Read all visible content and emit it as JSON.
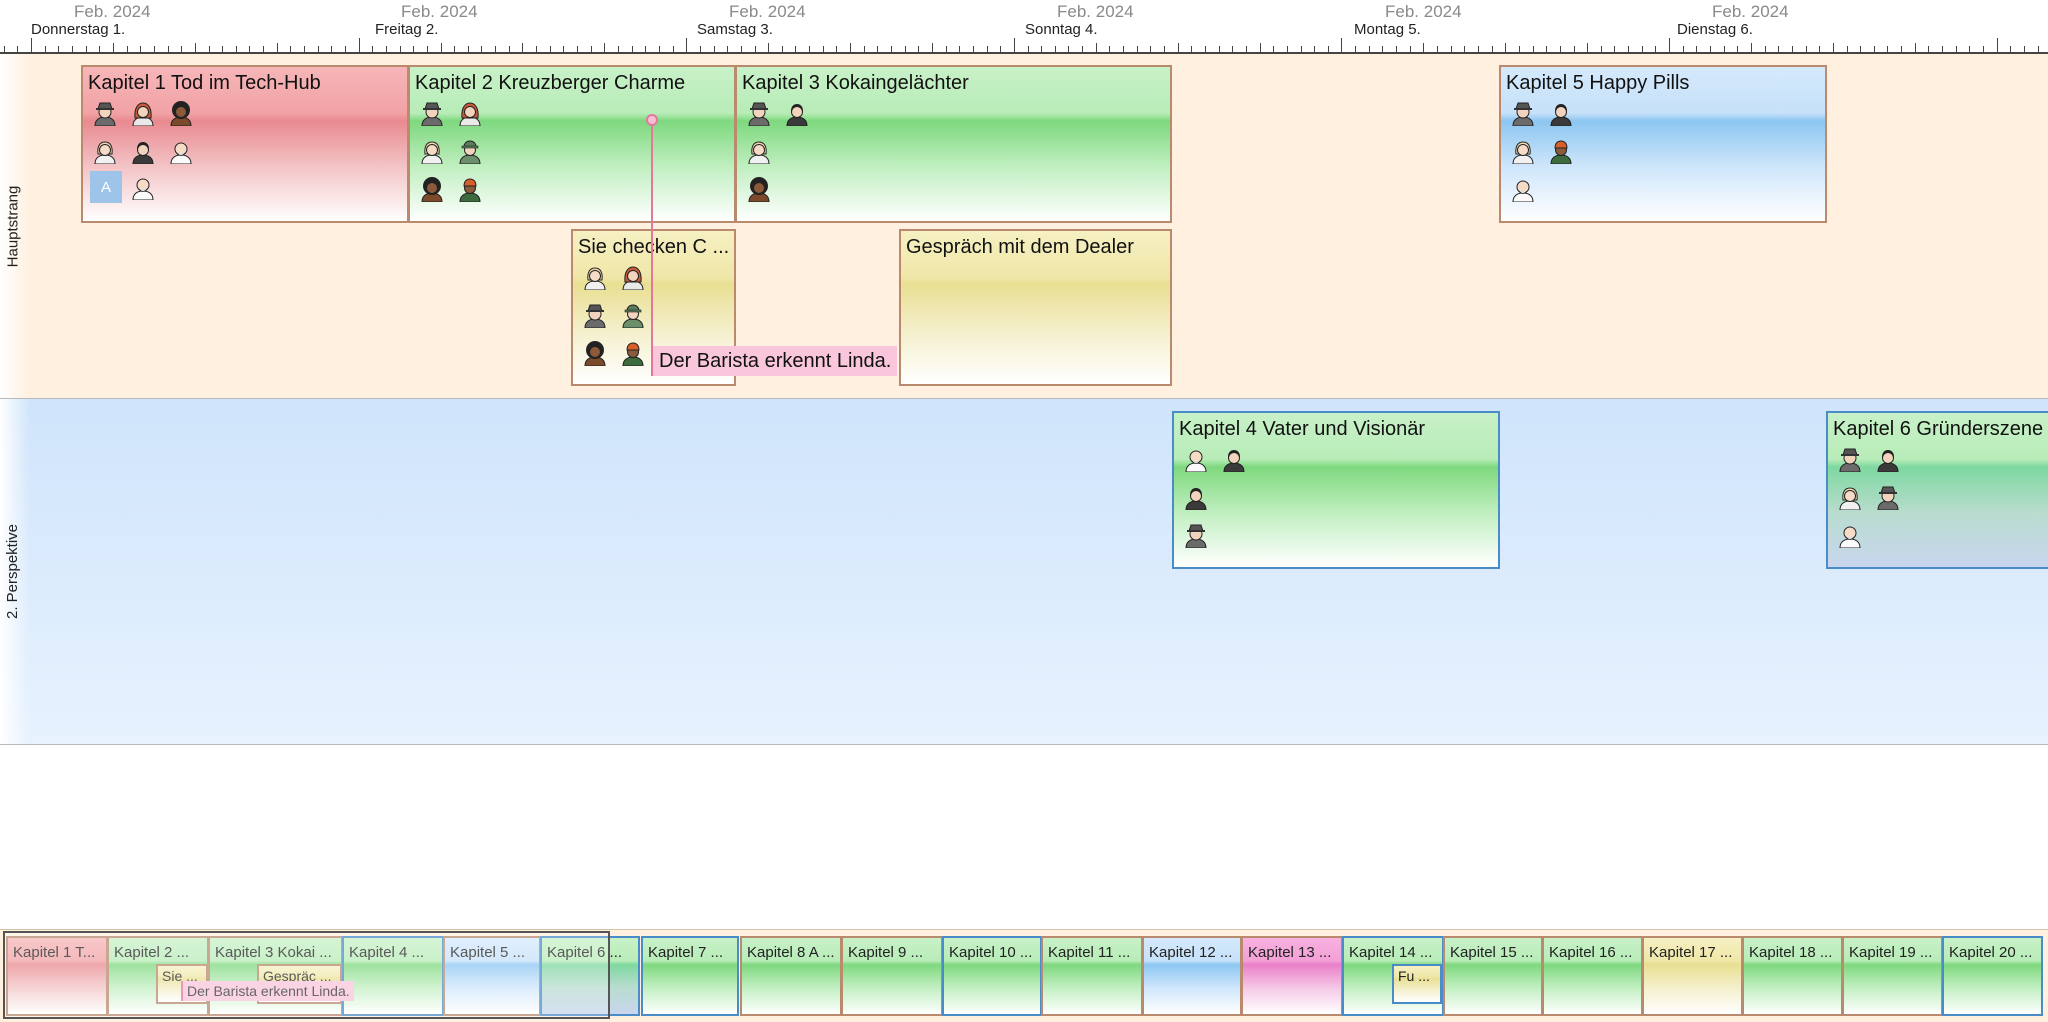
{
  "timeline": {
    "month_label": "Feb. 2024",
    "days": [
      "Donnerstag 1.",
      "Freitag 2.",
      "Samstag 3.",
      "Sonntag 4.",
      "Montag 5.",
      "Dienstag 6."
    ]
  },
  "lanes": {
    "main": "Hauptstrang",
    "perspective": "2. Perspektive"
  },
  "events": {
    "k1": "Kapitel 1 Tod im Tech-Hub",
    "k1_box": "A",
    "k2": "Kapitel 2 Kreuzberger Charme",
    "k3": "Kapitel 3 Kokaingelächter",
    "k5": "Kapitel 5 Happy Pills",
    "sie": "Sie checken C ...",
    "dealer": "Gespräch mit dem Dealer",
    "k4": "Kapitel 4 Vater und Visionär",
    "k6": "Kapitel 6 Gründerszene"
  },
  "note": "Der Barista erkennt Linda.",
  "overview": {
    "items": [
      "Kapitel 1 T...",
      "Kapitel 2 ...",
      "Kapitel 3 Kokai ...",
      "Kapitel 4 ...",
      "Kapitel 5 ...",
      "Kapitel 6 ...",
      "Kapitel 7 ...",
      "Kapitel 8 A ...",
      "Kapitel 9 ...",
      "Kapitel 10 ...",
      "Kapitel 11 ...",
      "Kapitel 12 ...",
      "Kapitel 13 ...",
      "Kapitel 14 ...",
      "Kapitel 15 ...",
      "Kapitel 16 ...",
      "Kapitel 17 ...",
      "Kapitel 18 ...",
      "Kapitel 19 ...",
      "Kapitel 20 ..."
    ],
    "sie": "Sie ...",
    "dealer": "Gespräc ...",
    "fu": "Fu ...",
    "note": "Der Barista erkennt Linda."
  },
  "colors": {
    "lane_main": "#fff0e0",
    "lane_perspective": "#d7e9fc",
    "card_border_brown": "#b98a6e",
    "card_border_blue": "#4a8cc7",
    "note_pink": "#f9c6dc",
    "note_line": "#e4789b"
  }
}
